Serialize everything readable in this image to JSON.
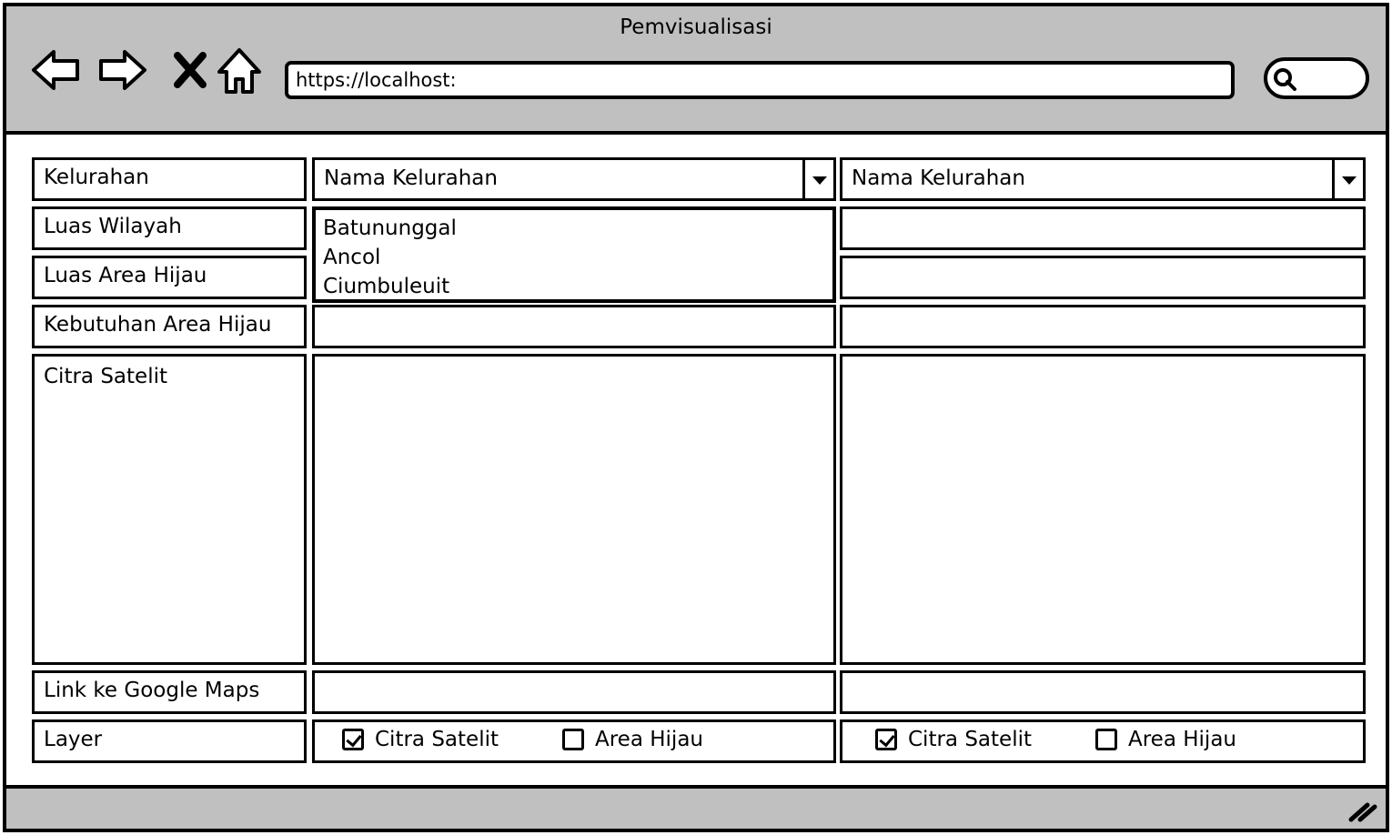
{
  "window": {
    "title": "Pemvisualisasi"
  },
  "browser": {
    "url": "https://localhost:"
  },
  "labels": {
    "kelurahan": "Kelurahan",
    "luas_wilayah": "Luas Wilayah",
    "luas_area_hijau": "Luas Area Hijau",
    "kebutuhan_area_hijau": "Kebutuhan Area Hijau",
    "citra_satelit": "Citra Satelit",
    "link_maps": "Link ke Google Maps",
    "layer": "Layer"
  },
  "left_panel": {
    "select_value": "Nama Kelurahan",
    "options": [
      "Batununggal",
      "Ancol",
      "Ciumbuleuit"
    ],
    "layers": [
      {
        "label": "Citra Satelit",
        "checked": true
      },
      {
        "label": "Area Hijau",
        "checked": false
      }
    ]
  },
  "right_panel": {
    "select_value": "Nama Kelurahan",
    "layers": [
      {
        "label": "Citra Satelit",
        "checked": true
      },
      {
        "label": "Area Hijau",
        "checked": false
      }
    ]
  },
  "icons": [
    "back-arrow-icon",
    "forward-arrow-icon",
    "close-icon",
    "home-icon",
    "search-icon",
    "resize-grip-icon"
  ]
}
